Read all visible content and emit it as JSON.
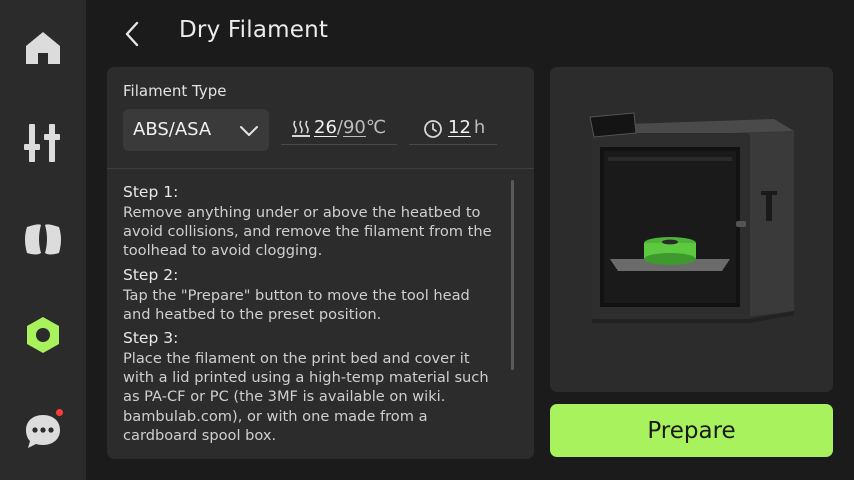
{
  "nav": {
    "items": [
      {
        "name": "home",
        "icon": "home-icon"
      },
      {
        "name": "controls",
        "icon": "sliders-icon"
      },
      {
        "name": "filament",
        "icon": "filament-spool-icon"
      },
      {
        "name": "utilities",
        "icon": "hex-nut-icon",
        "active": true
      },
      {
        "name": "messages",
        "icon": "chat-bubble-icon",
        "has_notification": true
      }
    ],
    "active_color": "#a7f25d"
  },
  "header": {
    "title": "Dry Filament"
  },
  "settings": {
    "label": "Filament Type",
    "filament_type": "ABS/ASA",
    "temp_current": "26",
    "temp_separator": "/",
    "temp_target": "90",
    "temp_unit": "℃",
    "time_value": "12",
    "time_unit": "h"
  },
  "steps": [
    {
      "heading": "Step 1:",
      "text": "Remove anything under or above the heatbed to avoid collisions, and remove the filament from the toolhead to avoid clogging."
    },
    {
      "heading": "Step 2:",
      "text": "Tap the \"Prepare\" button to move the tool head and heatbed to the preset position."
    },
    {
      "heading": "Step 3:",
      "text": "Place the filament on the print bed and cover it with a lid printed using a high-temp material such as PA-CF or PC (the 3MF is available on wiki. bambulab.com), or with one made from a cardboard spool box."
    }
  ],
  "action": {
    "prepare_label": "Prepare"
  }
}
